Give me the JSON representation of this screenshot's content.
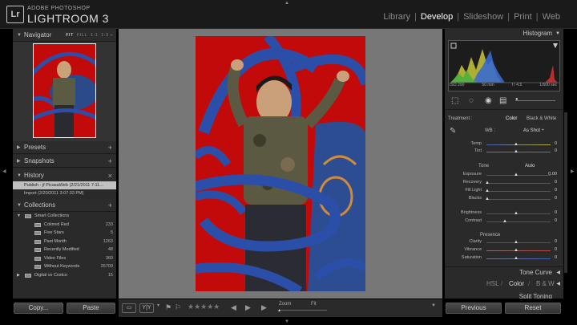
{
  "app": {
    "brand_sub": "ADOBE PHOTOSHOP",
    "brand_main": "LIGHTROOM 3",
    "logo": "Lr"
  },
  "modules": [
    "Library",
    "Develop",
    "Slideshow",
    "Print",
    "Web"
  ],
  "active_module": "Develop",
  "navigator": {
    "title": "Navigator",
    "opts": [
      "FIT",
      "FILL",
      "1:1",
      "1:3"
    ]
  },
  "panels": {
    "presets": "Presets",
    "snapshots": "Snapshots",
    "history": "History",
    "collections": "Collections"
  },
  "history": [
    "Publish - jf PicasaWeb (2/21/2011 7:11...",
    "Import (2/20/2011 3:07:33 PM)"
  ],
  "collections": {
    "group": "Smart Collections",
    "items": [
      {
        "name": "Colored Red",
        "count": "233"
      },
      {
        "name": "Five Stars",
        "count": "5"
      },
      {
        "name": "Past Month",
        "count": "1263"
      },
      {
        "name": "Recently Modified",
        "count": "48"
      },
      {
        "name": "Video Files",
        "count": "360"
      },
      {
        "name": "Without Keywords",
        "count": "26709"
      }
    ],
    "extra": {
      "name": "Digital vs Costco",
      "count": "15"
    }
  },
  "left_buttons": {
    "copy": "Copy...",
    "paste": "Paste"
  },
  "toolbar": {
    "stars": "★★★★★",
    "zoom_label": "Zoom",
    "fit_label": "Fit"
  },
  "histogram": {
    "title": "Histogram",
    "iso": "ISO 200",
    "focal": "50 mm",
    "aperture": "f / 4.5",
    "shutter": "1/500 sec"
  },
  "basic": {
    "treatment_label": "Treatment :",
    "color": "Color",
    "bw": "Black & White",
    "wb_label": "WB :",
    "wb_value": "As Shot ÷",
    "tone_label": "Tone",
    "auto": "Auto",
    "presence_label": "Presence",
    "rows": [
      {
        "label": "Temp",
        "value": "0"
      },
      {
        "label": "Tint",
        "value": "0"
      },
      {
        "label": "Exposure",
        "value": "0.00"
      },
      {
        "label": "Recovery",
        "value": "0"
      },
      {
        "label": "Fill Light",
        "value": "0"
      },
      {
        "label": "Blacks",
        "value": "0"
      },
      {
        "label": "Brightness",
        "value": "0"
      },
      {
        "label": "Contrast",
        "value": "0"
      },
      {
        "label": "Clarity",
        "value": "0"
      },
      {
        "label": "Vibrance",
        "value": "0"
      },
      {
        "label": "Saturation",
        "value": "0"
      }
    ]
  },
  "right_sections": {
    "tone_curve": "Tone Curve",
    "hsl": "HSL",
    "color": "Color",
    "bw": "B & W",
    "split": "Split Toning"
  },
  "right_buttons": {
    "previous": "Previous",
    "reset": "Reset"
  },
  "colors": {
    "mask_red": "#c20a0a",
    "accent": "#ffffff"
  }
}
